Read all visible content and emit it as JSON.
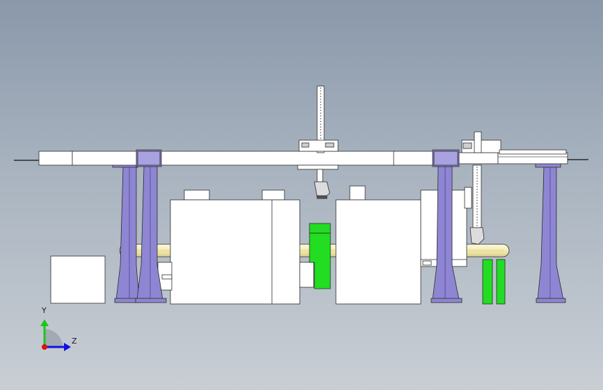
{
  "view": {
    "background_top": "#8a98aa",
    "background_bottom": "#c9ced4"
  },
  "triad": {
    "y_label": "Y",
    "z_label": "Z",
    "y_color": "#18c818",
    "z_color": "#1010e0",
    "x_color": "#e01010"
  },
  "colors": {
    "gantry_column": "#8e86d2",
    "gantry_column_dark": "#6e66b8",
    "machine_body": "#ffffff",
    "conveyor_tube": "#f5efbc",
    "green_part": "#22dd22",
    "line": "#2a2a2a"
  },
  "components": [
    "gantry-beam",
    "gantry-column",
    "machine-tool",
    "conveyor",
    "robot-slide",
    "green-fixture",
    "control-cabinet",
    "coordinate-triad"
  ]
}
